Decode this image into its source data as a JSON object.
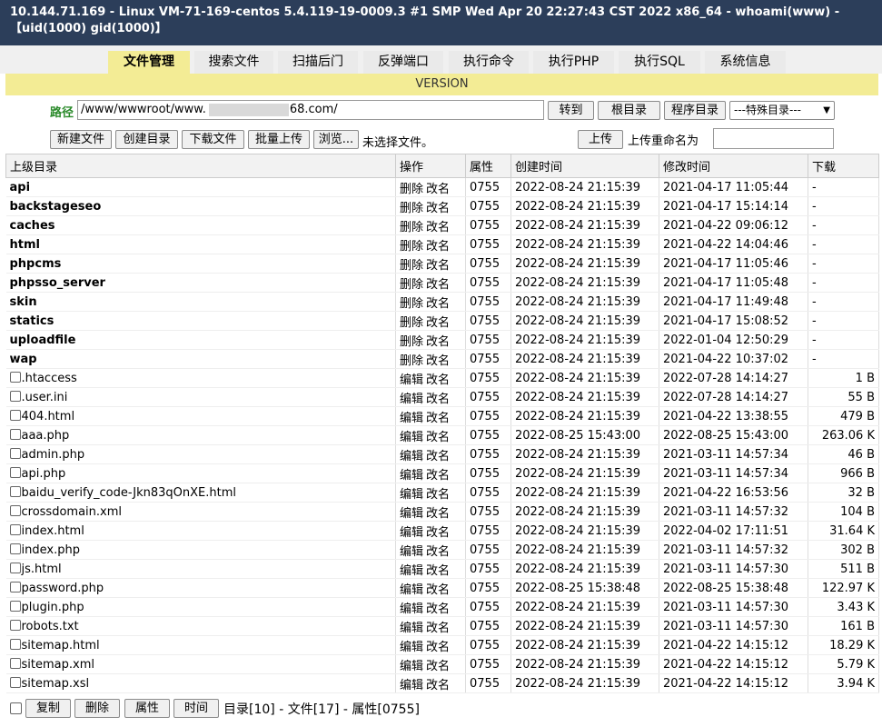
{
  "header": {
    "system_info": "10.144.71.169 - Linux VM-71-169-centos 5.4.119-19-0009.3 #1 SMP Wed Apr 20 22:27:43 CST 2022 x86_64 - whoami(www) - 【uid(1000) gid(1000)】"
  },
  "nav": {
    "tabs": [
      "文件管理",
      "搜索文件",
      "扫描后门",
      "反弹端口",
      "执行命令",
      "执行PHP",
      "执行SQL",
      "系统信息"
    ],
    "active": "文件管理"
  },
  "version_label": "VERSION",
  "pathbar": {
    "label": "路径",
    "path_prefix": "/www/wwwroot/www.",
    "path_suffix": "68.com/",
    "goto_button": "转到",
    "root_button": "根目录",
    "program_button": "程序目录",
    "special_select": "---特殊目录---"
  },
  "toolbar": {
    "new_file": "新建文件",
    "create_dir": "创建目录",
    "download_file": "下载文件",
    "batch_upload": "批量上传",
    "browse": "浏览...",
    "no_file_selected": "未选择文件。",
    "upload": "上传",
    "rename_label": "上传重命名为",
    "rename_value": ""
  },
  "table": {
    "headers": {
      "parent": "上级目录",
      "ops": "操作",
      "perm": "属性",
      "created": "创建时间",
      "modified": "修改时间",
      "download": "下载"
    },
    "dir_ops": [
      "删除",
      "改名"
    ],
    "file_ops": [
      "编辑",
      "改名"
    ],
    "dirs": [
      {
        "name": "api",
        "perm": "0755",
        "created": "2022-08-24 21:15:39",
        "modified": "2021-04-17 11:05:44",
        "size": "-"
      },
      {
        "name": "backstageseo",
        "perm": "0755",
        "created": "2022-08-24 21:15:39",
        "modified": "2021-04-17 15:14:14",
        "size": "-"
      },
      {
        "name": "caches",
        "perm": "0755",
        "created": "2022-08-24 21:15:39",
        "modified": "2021-04-22 09:06:12",
        "size": "-"
      },
      {
        "name": "html",
        "perm": "0755",
        "created": "2022-08-24 21:15:39",
        "modified": "2021-04-22 14:04:46",
        "size": "-"
      },
      {
        "name": "phpcms",
        "perm": "0755",
        "created": "2022-08-24 21:15:39",
        "modified": "2021-04-17 11:05:46",
        "size": "-"
      },
      {
        "name": "phpsso_server",
        "perm": "0755",
        "created": "2022-08-24 21:15:39",
        "modified": "2021-04-17 11:05:48",
        "size": "-"
      },
      {
        "name": "skin",
        "perm": "0755",
        "created": "2022-08-24 21:15:39",
        "modified": "2021-04-17 11:49:48",
        "size": "-"
      },
      {
        "name": "statics",
        "perm": "0755",
        "created": "2022-08-24 21:15:39",
        "modified": "2021-04-17 15:08:52",
        "size": "-"
      },
      {
        "name": "uploadfile",
        "perm": "0755",
        "created": "2022-08-24 21:15:39",
        "modified": "2022-01-04 12:50:29",
        "size": "-"
      },
      {
        "name": "wap",
        "perm": "0755",
        "created": "2022-08-24 21:15:39",
        "modified": "2021-04-22 10:37:02",
        "size": "-"
      }
    ],
    "files": [
      {
        "name": ".htaccess",
        "perm": "0755",
        "created": "2022-08-24 21:15:39",
        "modified": "2022-07-28 14:14:27",
        "size": "1 B"
      },
      {
        "name": ".user.ini",
        "perm": "0755",
        "created": "2022-08-24 21:15:39",
        "modified": "2022-07-28 14:14:27",
        "size": "55 B"
      },
      {
        "name": "404.html",
        "perm": "0755",
        "created": "2022-08-24 21:15:39",
        "modified": "2021-04-22 13:38:55",
        "size": "479 B"
      },
      {
        "name": "aaa.php",
        "perm": "0755",
        "created": "2022-08-25 15:43:00",
        "modified": "2022-08-25 15:43:00",
        "size": "263.06 K"
      },
      {
        "name": "admin.php",
        "perm": "0755",
        "created": "2022-08-24 21:15:39",
        "modified": "2021-03-11 14:57:34",
        "size": "46 B"
      },
      {
        "name": "api.php",
        "perm": "0755",
        "created": "2022-08-24 21:15:39",
        "modified": "2021-03-11 14:57:34",
        "size": "966 B"
      },
      {
        "name": "baidu_verify_code-Jkn83qOnXE.html",
        "perm": "0755",
        "created": "2022-08-24 21:15:39",
        "modified": "2021-04-22 16:53:56",
        "size": "32 B"
      },
      {
        "name": "crossdomain.xml",
        "perm": "0755",
        "created": "2022-08-24 21:15:39",
        "modified": "2021-03-11 14:57:32",
        "size": "104 B"
      },
      {
        "name": "index.html",
        "perm": "0755",
        "created": "2022-08-24 21:15:39",
        "modified": "2022-04-02 17:11:51",
        "size": "31.64 K"
      },
      {
        "name": "index.php",
        "perm": "0755",
        "created": "2022-08-24 21:15:39",
        "modified": "2021-03-11 14:57:32",
        "size": "302 B"
      },
      {
        "name": "js.html",
        "perm": "0755",
        "created": "2022-08-24 21:15:39",
        "modified": "2021-03-11 14:57:30",
        "size": "511 B"
      },
      {
        "name": "password.php",
        "perm": "0755",
        "created": "2022-08-25 15:38:48",
        "modified": "2022-08-25 15:38:48",
        "size": "122.97 K"
      },
      {
        "name": "plugin.php",
        "perm": "0755",
        "created": "2022-08-24 21:15:39",
        "modified": "2021-03-11 14:57:30",
        "size": "3.43 K"
      },
      {
        "name": "robots.txt",
        "perm": "0755",
        "created": "2022-08-24 21:15:39",
        "modified": "2021-03-11 14:57:30",
        "size": "161 B"
      },
      {
        "name": "sitemap.html",
        "perm": "0755",
        "created": "2022-08-24 21:15:39",
        "modified": "2021-04-22 14:15:12",
        "size": "18.29 K"
      },
      {
        "name": "sitemap.xml",
        "perm": "0755",
        "created": "2022-08-24 21:15:39",
        "modified": "2021-04-22 14:15:12",
        "size": "5.79 K"
      },
      {
        "name": "sitemap.xsl",
        "perm": "0755",
        "created": "2022-08-24 21:15:39",
        "modified": "2021-04-22 14:15:12",
        "size": "3.94 K"
      }
    ]
  },
  "footer": {
    "copy": "复制",
    "delete": "删除",
    "attribute": "属性",
    "time": "时间",
    "summary": "目录[10] - 文件[17] - 属性[0755]"
  },
  "colors": {
    "header_bg": "#2c3e5a",
    "tab_active_bg": "#f3ec95",
    "version_bar_bg": "#f3ec95",
    "path_label": "#2a8a2a"
  }
}
